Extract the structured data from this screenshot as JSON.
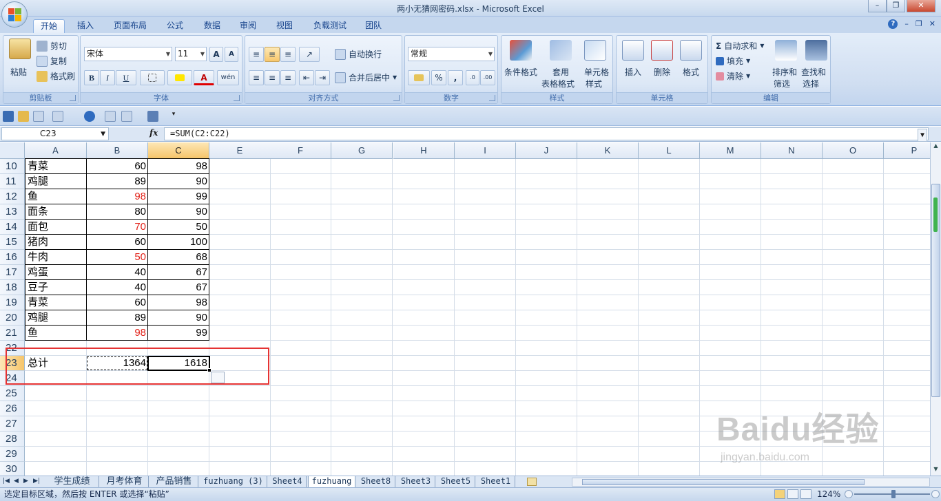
{
  "window": {
    "title": "两小无猜网密码.xlsx - Microsoft Excel",
    "controls": [
      "–",
      "❐",
      "✕"
    ]
  },
  "tabs": [
    "开始",
    "插入",
    "页面布局",
    "公式",
    "数据",
    "审阅",
    "视图",
    "负载测试",
    "团队"
  ],
  "ribbon": {
    "clipboard": {
      "paste": "粘贴",
      "cut": "剪切",
      "copy": "复制",
      "format_painter": "格式刷",
      "label": "剪贴板"
    },
    "font": {
      "name": "宋体",
      "size": "11",
      "grow": "A",
      "shrink": "A",
      "bold": "B",
      "italic": "I",
      "underline": "U",
      "font_color_glyph": "A",
      "phonetic": "wén",
      "label": "字体"
    },
    "alignment": {
      "wrap": "自动换行",
      "merge": "合并后居中",
      "label": "对齐方式"
    },
    "number": {
      "format": "常规",
      "percent": "%",
      "comma": ",",
      "inc_decimal": ".0",
      "dec_decimal": ".00",
      "label": "数字"
    },
    "styles": {
      "conditional": "条件格式",
      "table_format_1": "套用",
      "table_format_2": "表格格式",
      "cell_style_1": "单元格",
      "cell_style_2": "样式",
      "label": "样式"
    },
    "cells": {
      "insert": "插入",
      "delete": "删除",
      "format": "格式",
      "label": "单元格"
    },
    "editing": {
      "autosum": "自动求和",
      "fill": "填充",
      "clear": "清除",
      "sort_1": "排序和",
      "sort_2": "筛选",
      "find_1": "查找和",
      "find_2": "选择",
      "label": "编辑"
    }
  },
  "formula_bar": {
    "name_box": "C23",
    "fx": "fx",
    "formula": "=SUM(C2:C22)"
  },
  "columns": [
    "A",
    "B",
    "C",
    "E",
    "F",
    "G",
    "H",
    "I",
    "J",
    "K",
    "L",
    "M",
    "N",
    "O",
    "P"
  ],
  "rows": [
    {
      "num": "10",
      "a": "青菜",
      "b": "60",
      "c": "98",
      "b_red": false
    },
    {
      "num": "11",
      "a": "鸡腿",
      "b": "89",
      "c": "90",
      "b_red": false
    },
    {
      "num": "12",
      "a": "鱼",
      "b": "98",
      "c": "99",
      "b_red": true
    },
    {
      "num": "13",
      "a": "面条",
      "b": "80",
      "c": "90",
      "b_red": false
    },
    {
      "num": "14",
      "a": "面包",
      "b": "70",
      "c": "50",
      "b_red": true
    },
    {
      "num": "15",
      "a": "猪肉",
      "b": "60",
      "c": "100",
      "b_red": false
    },
    {
      "num": "16",
      "a": "牛肉",
      "b": "50",
      "c": "68",
      "b_red": true
    },
    {
      "num": "17",
      "a": "鸡蛋",
      "b": "40",
      "c": "67",
      "b_red": false
    },
    {
      "num": "18",
      "a": "豆子",
      "b": "40",
      "c": "67",
      "b_red": false
    },
    {
      "num": "19",
      "a": "青菜",
      "b": "60",
      "c": "98",
      "b_red": false
    },
    {
      "num": "20",
      "a": "鸡腿",
      "b": "89",
      "c": "90",
      "b_red": false
    },
    {
      "num": "21",
      "a": "鱼",
      "b": "98",
      "c": "99",
      "b_red": true
    },
    {
      "num": "22",
      "a": "",
      "b": "",
      "c": "",
      "b_red": false
    },
    {
      "num": "23",
      "a": "总计",
      "b": "1364",
      "c": "1618",
      "b_red": false
    },
    {
      "num": "24",
      "a": "",
      "b": "",
      "c": "",
      "b_red": false
    },
    {
      "num": "25",
      "a": "",
      "b": "",
      "c": "",
      "b_red": false
    },
    {
      "num": "26",
      "a": "",
      "b": "",
      "c": "",
      "b_red": false
    },
    {
      "num": "27",
      "a": "",
      "b": "",
      "c": "",
      "b_red": false
    },
    {
      "num": "28",
      "a": "",
      "b": "",
      "c": "",
      "b_red": false
    },
    {
      "num": "29",
      "a": "",
      "b": "",
      "c": "",
      "b_red": false
    },
    {
      "num": "30",
      "a": "",
      "b": "",
      "c": "",
      "b_red": false
    }
  ],
  "sheets": [
    "学生成绩",
    "月考体育",
    "产品销售",
    "fuzhuang (3)",
    "Sheet4",
    "fuzhuang",
    "Sheet8",
    "Sheet3",
    "Sheet5",
    "Sheet1"
  ],
  "active_sheet": "fuzhuang",
  "status": {
    "message": "选定目标区域，然后按 ENTER 或选择“粘贴”",
    "zoom": "124%"
  },
  "watermark": {
    "brand": "Baidu经验",
    "url": "jingyan.baidu.com"
  },
  "colors": {
    "accent": "#15428b",
    "highlight": "#e53333",
    "red_value": "#e2231a"
  }
}
